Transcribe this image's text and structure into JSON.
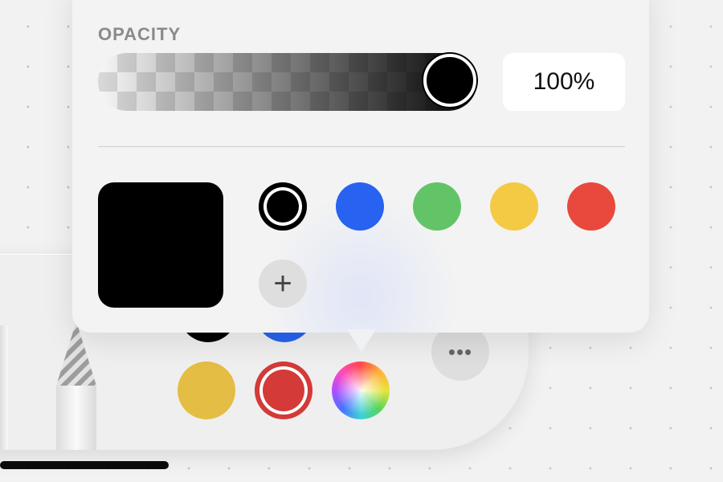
{
  "popover": {
    "opacity_label": "OPACITY",
    "opacity_value": "100%",
    "opacity_level": 1.0,
    "current_color": "#000000",
    "swatches": [
      {
        "name": "black",
        "color": "#000000",
        "selected": true
      },
      {
        "name": "blue",
        "color": "#2762f0"
      },
      {
        "name": "green",
        "color": "#62c466"
      },
      {
        "name": "yellow",
        "color": "#f4ca44"
      },
      {
        "name": "red",
        "color": "#e8493c"
      }
    ],
    "add_icon": "plus-icon",
    "add_glyph": "+"
  },
  "palette": {
    "swatches": [
      {
        "name": "yellow",
        "color": "#e4bd44"
      },
      {
        "name": "red",
        "color": "#d33a38",
        "selected": true
      },
      {
        "name": "multicolor",
        "color": "conic"
      }
    ],
    "more_icon": "ellipsis-icon",
    "more_glyph": "•••"
  }
}
